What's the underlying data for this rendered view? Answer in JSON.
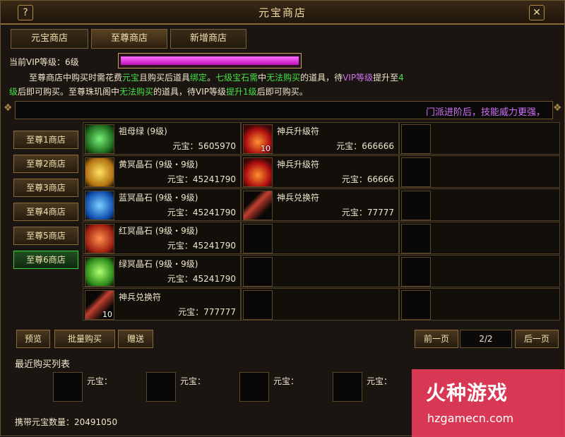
{
  "window": {
    "title": "元宝商店",
    "help_label": "?",
    "close_label": "✕"
  },
  "tabs": [
    {
      "label": "元宝商店"
    },
    {
      "label": "至尊商店"
    },
    {
      "label": "新增商店"
    }
  ],
  "vip": {
    "label": "当前VIP等级：6级",
    "progress": 1.0
  },
  "notice": {
    "line1_a": "至尊商店中购买时需花费",
    "line1_b": "元宝",
    "line1_c": "且购买后道具",
    "line1_d": "绑定",
    "line1_e": "。",
    "line1_f": "七级宝石需",
    "line1_g": "中",
    "line1_h": "无法购买",
    "line1_i": "的道具，待",
    "line1_j": "VIP等级",
    "line1_k": "提升至",
    "line1_l": "4",
    "line2_a": "级",
    "line2_b": "后即可购买。至尊珠玑阁中",
    "line2_c": "无法购买",
    "line2_d": "的道具，待VIP等级",
    "line2_e": "提升1级",
    "line2_f": "后即可购买。"
  },
  "marquee": "门派进阶后，技能威力更强，",
  "side_tabs": [
    "至尊1商店",
    "至尊2商店",
    "至尊3商店",
    "至尊4商店",
    "至尊5商店",
    "至尊6商店"
  ],
  "items_left": [
    {
      "name": "祖母绿 (9级)",
      "price": "元宝：5605970",
      "icon": "green-jade-icon"
    },
    {
      "name": "黄冥晶石 (9级・9级)",
      "price": "元宝：45241790",
      "icon": "yellow-crystal-icon"
    },
    {
      "name": "蓝冥晶石 (9级・9级)",
      "price": "元宝：45241790",
      "icon": "blue-crystal-icon"
    },
    {
      "name": "红冥晶石 (9级・9级)",
      "price": "元宝：45241790",
      "icon": "red-crystal-icon"
    },
    {
      "name": "绿冥晶石 (9级・9级)",
      "price": "元宝：45241790",
      "icon": "green-crystal-icon"
    },
    {
      "name": "神兵兑换符",
      "price": "元宝：777777",
      "icon": "scroll-icon",
      "count": "10"
    }
  ],
  "items_mid": [
    {
      "name": "神兵升级符",
      "price": "元宝：666666",
      "icon": "fire-rune-icon",
      "count": "10"
    },
    {
      "name": "神兵升级符",
      "price": "元宝：66666",
      "icon": "fire-rune-icon"
    },
    {
      "name": "神兵兑换符",
      "price": "元宝：77777",
      "icon": "scroll-icon"
    }
  ],
  "buttons": {
    "preview": "预览",
    "bulk_buy": "批量购买",
    "gift": "赠送",
    "prev": "前一页",
    "next": "后一页",
    "page": "2/2"
  },
  "recent": {
    "label": "最近购买列表",
    "price_label": "元宝："
  },
  "carry": {
    "label": "携带元宝数量：20491050"
  },
  "watermark": {
    "big": "火种游戏",
    "small": "hzgamecn.com"
  }
}
